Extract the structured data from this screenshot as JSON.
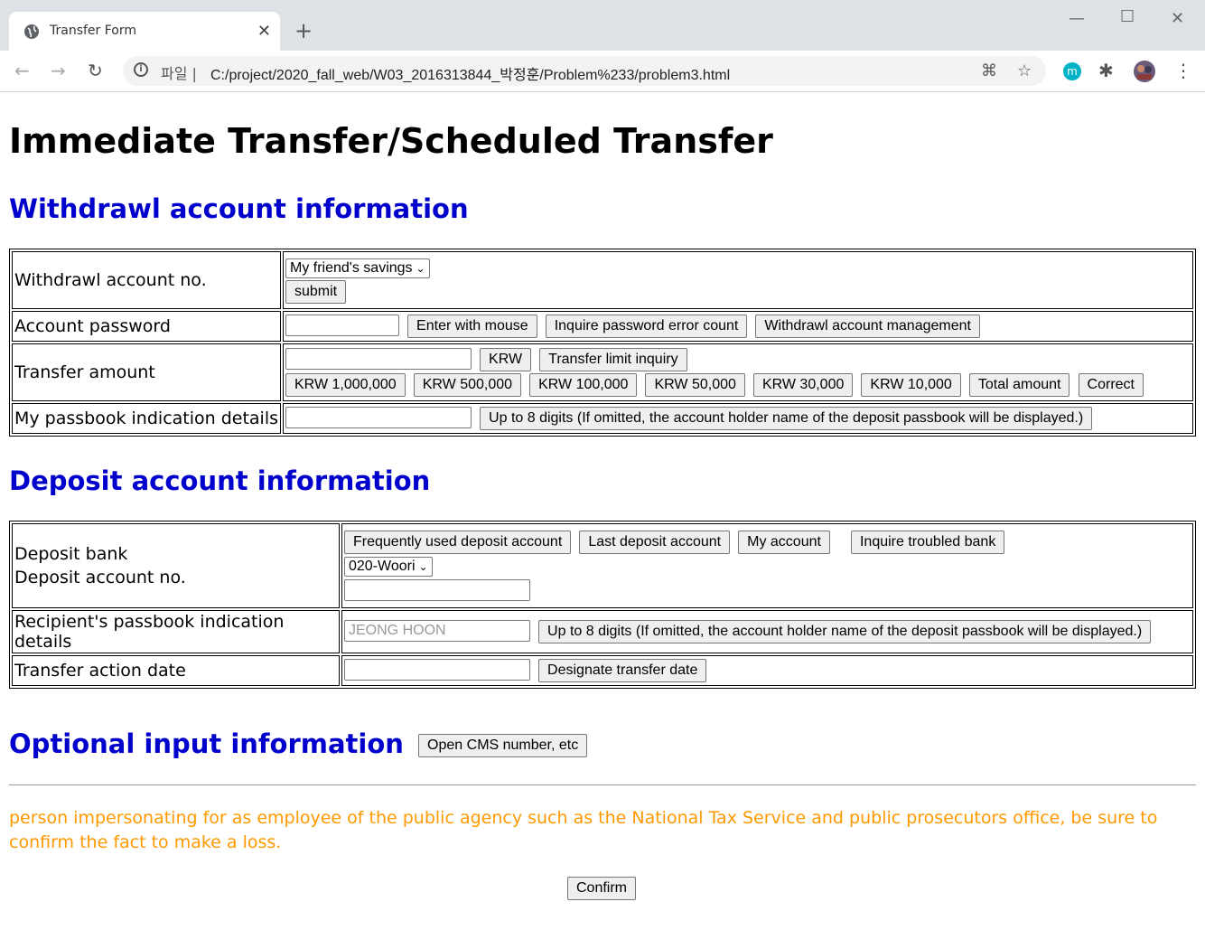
{
  "browser": {
    "tab_title": "Transfer Form",
    "scheme_label": "파일",
    "url": "C:/project/2020_fall_web/W03_2016313844_박정훈/Problem%233/problem3.html",
    "profile_initial": "m"
  },
  "page": {
    "title": "Immediate Transfer/Scheduled Transfer",
    "withdrawal": {
      "heading": "Withdrawl account information",
      "account_no_label": "Withdrawl account no.",
      "account_select": "My friend's savings",
      "submit_label": "submit",
      "password_label": "Account password",
      "enter_mouse_label": "Enter with mouse",
      "inquire_password_label": "Inquire password error count",
      "account_mgmt_label": "Withdrawl account management",
      "amount_label": "Transfer amount",
      "krw_label": "KRW",
      "limit_inquiry_label": "Transfer limit inquiry",
      "amount_buttons": [
        "KRW 1,000,000",
        "KRW 500,000",
        "KRW 100,000",
        "KRW 50,000",
        "KRW 30,000",
        "KRW 10,000",
        "Total amount",
        "Correct"
      ],
      "passbook_label": "My passbook indication details",
      "passbook_hint": "Up to 8 digits (If omitted, the account holder name of the deposit passbook will be displayed.)"
    },
    "deposit": {
      "heading": "Deposit account information",
      "bank_label": "Deposit bank",
      "account_no_label": "Deposit account no.",
      "frequent_label": "Frequently used deposit account",
      "last_label": "Last deposit account",
      "my_account_label": "My account",
      "troubled_label": "Inquire troubled bank",
      "bank_select": "020-Woori",
      "recipient_label": "Recipient's passbook indication details",
      "recipient_placeholder": "JEONG HOON",
      "recipient_hint": "Up to 8 digits (If omitted, the account holder name of the deposit passbook will be displayed.)",
      "date_label": "Transfer action date",
      "designate_label": "Designate transfer date"
    },
    "optional": {
      "heading": "Optional input information",
      "cms_label": "Open CMS number, etc"
    },
    "warning": "person impersonating for as employee of the public agency such as the National Tax Service and public prosecutors office, be sure to confirm the fact to make a loss.",
    "confirm_label": "Confirm"
  }
}
